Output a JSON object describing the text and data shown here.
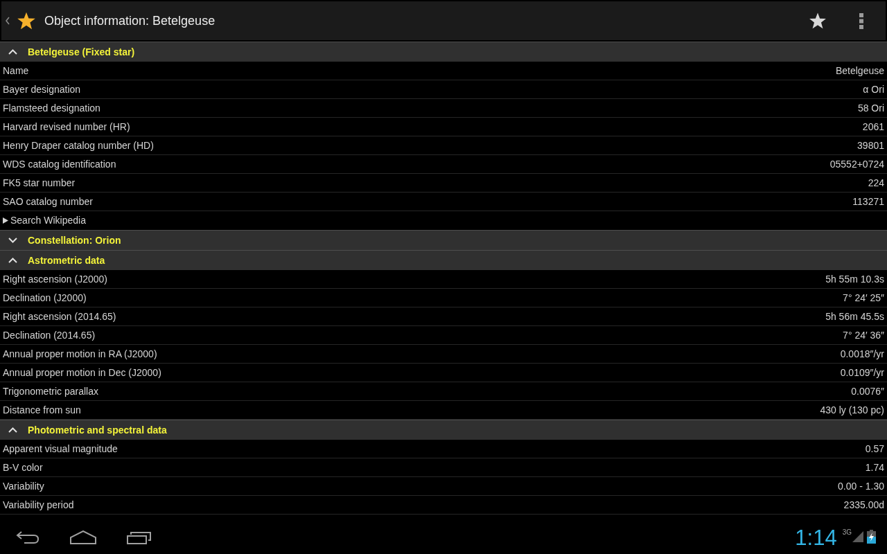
{
  "action_bar": {
    "title": "Object information: Betelgeuse"
  },
  "sections": [
    {
      "title": "Betelgeuse (Fixed star)",
      "expanded": true,
      "rows": [
        {
          "kind": "field",
          "label": "Name",
          "value": "Betelgeuse"
        },
        {
          "kind": "field",
          "label": "Bayer designation",
          "value": "α Ori"
        },
        {
          "kind": "field",
          "label": "Flamsteed designation",
          "value": "58 Ori"
        },
        {
          "kind": "field",
          "label": "Harvard revised number (HR)",
          "value": "2061"
        },
        {
          "kind": "field",
          "label": "Henry Draper catalog number (HD)",
          "value": "39801"
        },
        {
          "kind": "field",
          "label": "WDS catalog identification",
          "value": "05552+0724"
        },
        {
          "kind": "field",
          "label": "FK5 star number",
          "value": "224"
        },
        {
          "kind": "field",
          "label": "SAO catalog number",
          "value": "113271"
        },
        {
          "kind": "link",
          "label": "Search Wikipedia"
        }
      ]
    },
    {
      "title": "Constellation: Orion",
      "expanded": false
    },
    {
      "title": "Astrometric data",
      "expanded": true,
      "rows": [
        {
          "kind": "field",
          "label": "Right ascension (J2000)",
          "value": "5h 55m 10.3s"
        },
        {
          "kind": "field",
          "label": "Declination (J2000)",
          "value": "7° 24′ 25″"
        },
        {
          "kind": "field",
          "label": "Right ascension (2014.65)",
          "value": "5h 56m 45.5s"
        },
        {
          "kind": "field",
          "label": "Declination (2014.65)",
          "value": "7° 24′ 36″"
        },
        {
          "kind": "field",
          "label": "Annual proper motion in RA (J2000)",
          "value": "0.0018″/yr"
        },
        {
          "kind": "field",
          "label": "Annual proper motion in Dec (J2000)",
          "value": "0.0109″/yr"
        },
        {
          "kind": "field",
          "label": "Trigonometric parallax",
          "value": "0.0076″"
        },
        {
          "kind": "field",
          "label": "Distance from sun",
          "value": "430 ly (130 pc)"
        }
      ]
    },
    {
      "title": "Photometric and spectral data",
      "expanded": true,
      "rows": [
        {
          "kind": "field",
          "label": "Apparent visual magnitude",
          "value": "0.57"
        },
        {
          "kind": "field",
          "label": "B-V color",
          "value": "1.74"
        },
        {
          "kind": "field",
          "label": "Variability",
          "value": "0.00 - 1.30"
        },
        {
          "kind": "field",
          "label": "Variability period",
          "value": "2335.00d"
        }
      ]
    }
  ],
  "status_bar": {
    "time": "1:14",
    "network": "3G"
  }
}
